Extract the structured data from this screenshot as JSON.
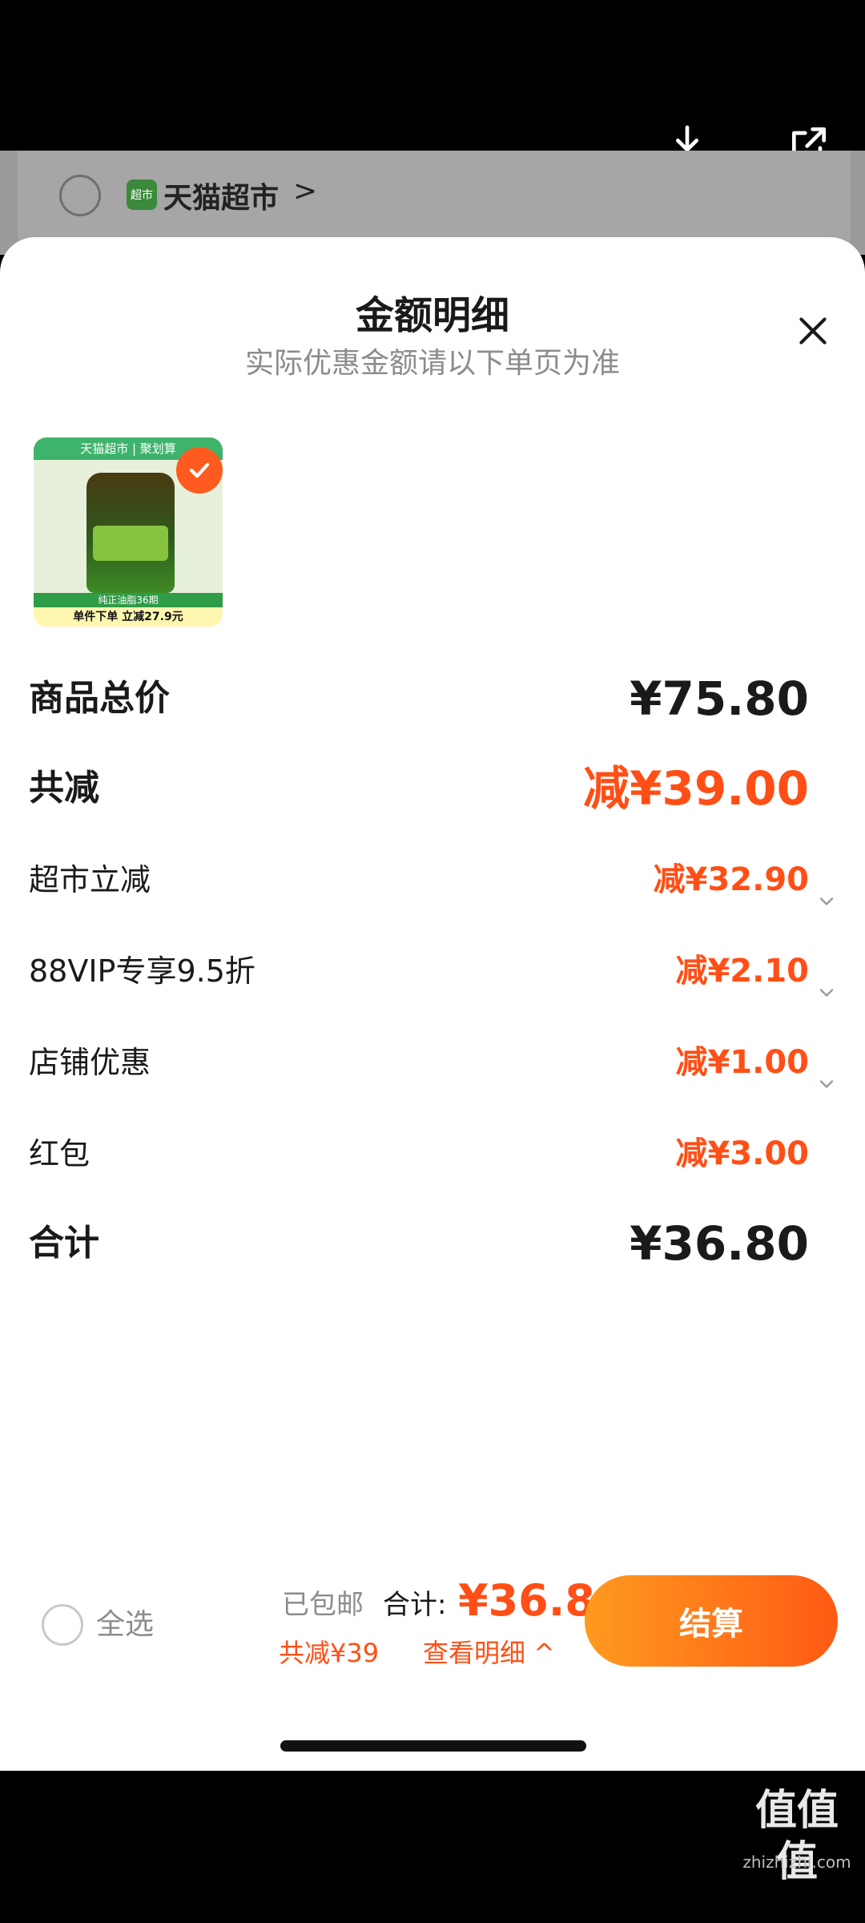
{
  "under_store": {
    "logo_text": "超市",
    "name": "天猫超市",
    "chevron": ">"
  },
  "sheet": {
    "title": "金额明细",
    "subtitle": "实际优惠金额请以下单页为准"
  },
  "product": {
    "top_banner": "天猫超市 | 聚划算",
    "strip_text": "纯正油脂36期",
    "bottom_text": "单件下单 立减27.9元"
  },
  "rows": {
    "subtotal": {
      "label": "商品总价",
      "value": "¥75.80"
    },
    "total_discount": {
      "label": "共减",
      "value": "减¥39.00"
    },
    "supermarket_discount": {
      "label": "超市立减",
      "value": "减¥32.90"
    },
    "vip_discount": {
      "label": "88VIP专享9.5折",
      "value": "减¥2.10"
    },
    "store_discount": {
      "label": "店铺优惠",
      "value": "减¥1.00"
    },
    "red_packet": {
      "label": "红包",
      "value": "减¥3.00"
    },
    "total": {
      "label": "合计",
      "value": "¥36.80"
    }
  },
  "bottom_bar": {
    "select_all": "全选",
    "shipping": "已包邮",
    "total_label": "合计:",
    "total_value": "¥36.8",
    "saving": "共减¥39",
    "detail_link": "查看明细 ^",
    "checkout": "结算"
  },
  "watermark": {
    "top": "值值值",
    "bottom": "zhizhizhi.com"
  },
  "colors": {
    "accent": "#ff4f16",
    "checkout_start": "#ff9a1f",
    "checkout_end": "#ff5a14"
  },
  "icons": [
    "download-icon",
    "share-icon",
    "close-icon",
    "check-icon",
    "chevron-down-icon"
  ]
}
